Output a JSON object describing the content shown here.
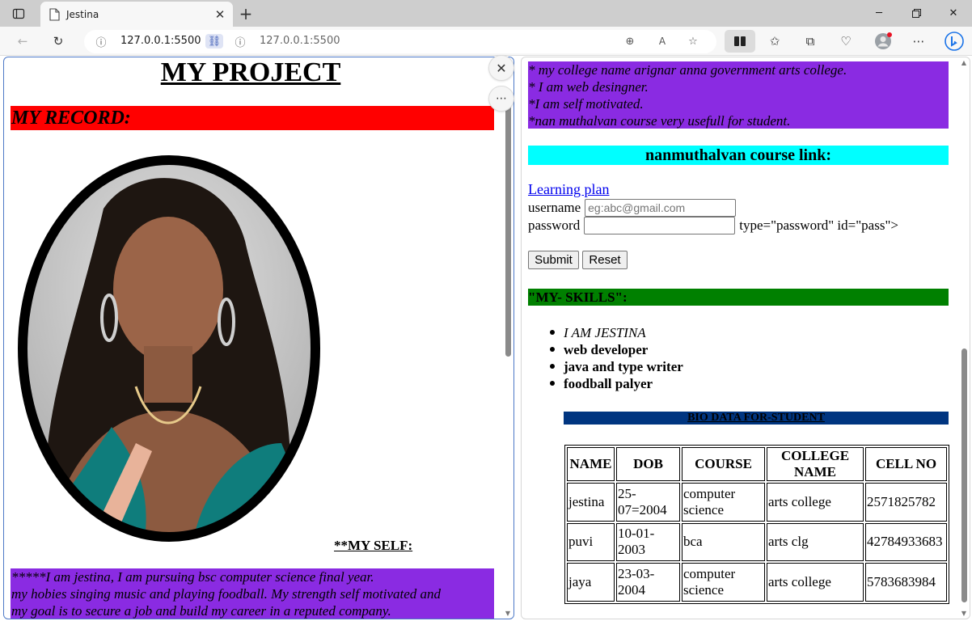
{
  "browser": {
    "tab_title": "Jestina",
    "address_left": "127.0.0.1:5500",
    "address_right": "127.0.0.1:5500"
  },
  "left": {
    "heading": "MY PROJECT",
    "record": "MY RECORD:",
    "photo_alt": "",
    "myself": "**MY SELF:",
    "about_lines": [
      "*****I am jestina, I am pursuing bsc computer science final year.",
      "my hobies singing music and playing foodball. My strength self motivated and",
      "my goal is to secure a job and build my career in a reputed company."
    ]
  },
  "right": {
    "purple_lines": [
      "* my college name arignar anna government arts college.",
      "* I am web desingner.",
      "*I am self motivated.",
      "*nan muthalvan course very usefull for student."
    ],
    "course_heading": "nanmuthalvan course link:",
    "link": "Learning plan",
    "username_label": "username",
    "username_placeholder": "eg:abc@gmail.com",
    "password_label": "password",
    "password_trailing": "type=\"password\" id=\"pass\">",
    "submit": "Submit",
    "reset": "Reset",
    "skills_heading": "\"MY- SKILLS\":",
    "skills": [
      "I AM JESTINA",
      "web developer",
      "java and type writer",
      "foodball palyer"
    ],
    "bio_heading": "BIO DATA FOR-STUDENT",
    "table": {
      "headers": [
        "NAME",
        "DOB",
        "COURSE",
        "COLLEGE NAME",
        "CELL NO"
      ],
      "rows": [
        [
          "jestina",
          "25-07=2004",
          "computer science",
          "arts college",
          "2571825782"
        ],
        [
          "puvi",
          "10-01-2003",
          "bca",
          "arts clg",
          "42784933683"
        ],
        [
          "jaya",
          "23-03-2004",
          "computer science",
          "arts college",
          "5783683984"
        ]
      ]
    }
  },
  "colors": {
    "record_bg": "#ff0000",
    "about_bg": "#8a2be2",
    "course_bg": "#00ffff",
    "skills_bg": "#008000",
    "bio_bg": "#003580"
  }
}
